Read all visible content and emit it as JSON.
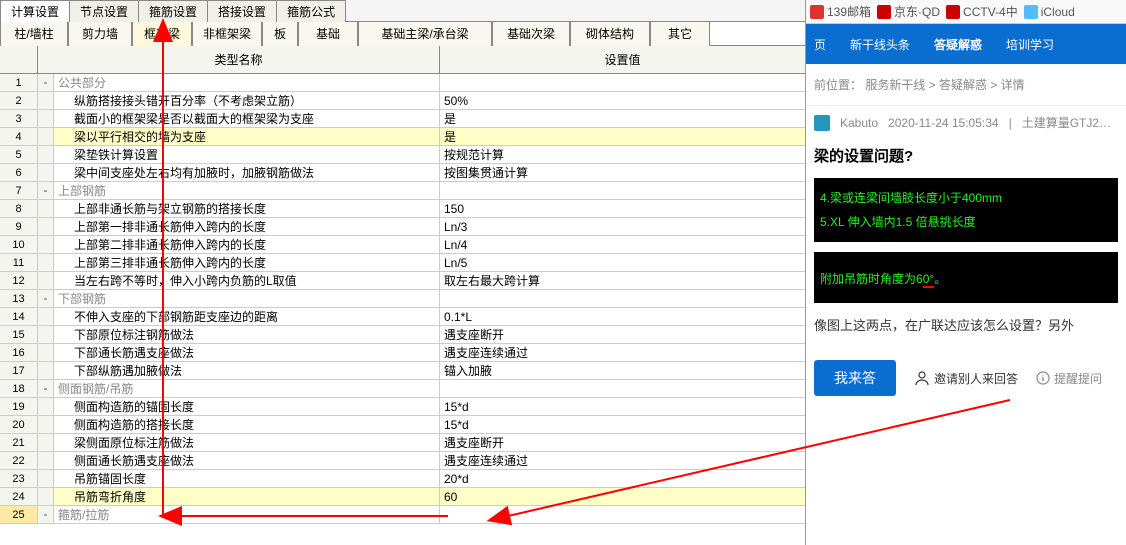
{
  "topTabs": [
    "计算设置",
    "节点设置",
    "箍筋设置",
    "搭接设置",
    "箍筋公式"
  ],
  "topTabActive": 0,
  "subTabs": [
    "柱/墙柱",
    "剪力墙",
    "框架梁",
    "非框架梁",
    "板",
    "基础",
    "基础主梁/承台梁",
    "基础次梁",
    "砌体结构",
    "其它"
  ],
  "subTabActive": 2,
  "gridHeader": {
    "name": "类型名称",
    "value": "设置值"
  },
  "rows": [
    {
      "n": 1,
      "toggle": "-",
      "name": "公共部分",
      "val": "",
      "section": true
    },
    {
      "n": 2,
      "name": "纵筋搭接接头错开百分率（不考虑架立筋）",
      "val": "50%",
      "indent": true
    },
    {
      "n": 3,
      "name": "截面小的框架梁是否以截面大的框架梁为支座",
      "val": "是",
      "indent": true
    },
    {
      "n": 4,
      "name": "梁以平行相交的墙为支座",
      "val": "是",
      "indent": true,
      "hl": true
    },
    {
      "n": 5,
      "name": "梁垫铁计算设置",
      "val": "按规范计算",
      "indent": true
    },
    {
      "n": 6,
      "name": "梁中间支座处左右均有加腋时，加腋钢筋做法",
      "val": "按图集贯通计算",
      "indent": true
    },
    {
      "n": 7,
      "toggle": "-",
      "name": "上部钢筋",
      "val": "",
      "section": true
    },
    {
      "n": 8,
      "name": "上部非通长筋与架立钢筋的搭接长度",
      "val": "150",
      "indent": true
    },
    {
      "n": 9,
      "name": "上部第一排非通长筋伸入跨内的长度",
      "val": "Ln/3",
      "indent": true
    },
    {
      "n": 10,
      "name": "上部第二排非通长筋伸入跨内的长度",
      "val": "Ln/4",
      "indent": true
    },
    {
      "n": 11,
      "name": "上部第三排非通长筋伸入跨内的长度",
      "val": "Ln/5",
      "indent": true
    },
    {
      "n": 12,
      "name": "当左右跨不等时，伸入小跨内负筋的L取值",
      "val": "取左右最大跨计算",
      "indent": true
    },
    {
      "n": 13,
      "toggle": "-",
      "name": "下部钢筋",
      "val": "",
      "section": true
    },
    {
      "n": 14,
      "name": "不伸入支座的下部钢筋距支座边的距离",
      "val": "0.1*L",
      "indent": true
    },
    {
      "n": 15,
      "name": "下部原位标注钢筋做法",
      "val": "遇支座断开",
      "indent": true
    },
    {
      "n": 16,
      "name": "下部通长筋遇支座做法",
      "val": "遇支座连续通过",
      "indent": true
    },
    {
      "n": 17,
      "name": "下部纵筋遇加腋做法",
      "val": "锚入加腋",
      "indent": true
    },
    {
      "n": 18,
      "toggle": "-",
      "name": "侧面钢筋/吊筋",
      "val": "",
      "section": true
    },
    {
      "n": 19,
      "name": "侧面构造筋的锚固长度",
      "val": "15*d",
      "indent": true
    },
    {
      "n": 20,
      "name": "侧面构造筋的搭接长度",
      "val": "15*d",
      "indent": true
    },
    {
      "n": 21,
      "name": "梁侧面原位标注筋做法",
      "val": "遇支座断开",
      "indent": true
    },
    {
      "n": 22,
      "name": "侧面通长筋遇支座做法",
      "val": "遇支座连续通过",
      "indent": true
    },
    {
      "n": 23,
      "name": "吊筋锚固长度",
      "val": "20*d",
      "indent": true
    },
    {
      "n": 24,
      "name": "吊筋弯折角度",
      "val": "60",
      "indent": true,
      "hl": true
    },
    {
      "n": 25,
      "toggle": "-",
      "name": "箍筋/拉筋",
      "val": "",
      "section": true,
      "row25": true
    }
  ],
  "browserTabs": [
    {
      "icon": "#d33",
      "label": "139邮箱"
    },
    {
      "icon": "#c00",
      "label": "京东·QD"
    },
    {
      "icon": "#c00",
      "label": "CCTV-4中"
    },
    {
      "icon": "#5bf",
      "label": "iCloud"
    }
  ],
  "navbar": {
    "items": [
      "页",
      "新干线头条",
      "答疑解惑",
      "培训学习"
    ],
    "activeIndex": 2
  },
  "breadcrumb": "前位置： 服务新干线 > 答疑解惑 > 详情",
  "post": {
    "author": "Kabuto",
    "time": "2020-11-24 15:05:34",
    "category": "土建算量GTJ2…",
    "title": "梁的设置问题?",
    "img1_line1": "4.梁或连梁间墙肢长度小于400mm",
    "img1_line2": "5.XL 伸入墙内1.5 倍悬挑长度",
    "img2_prefix": "附加吊筋时角度为6",
    "img2_under": "0°",
    "img2_suffix": "。",
    "desc": "像图上这两点，在广联达应该怎么设置？另外"
  },
  "answerBar": {
    "btn": "我来答",
    "invite": "邀请别人来回答",
    "remind": "提醒提问"
  }
}
